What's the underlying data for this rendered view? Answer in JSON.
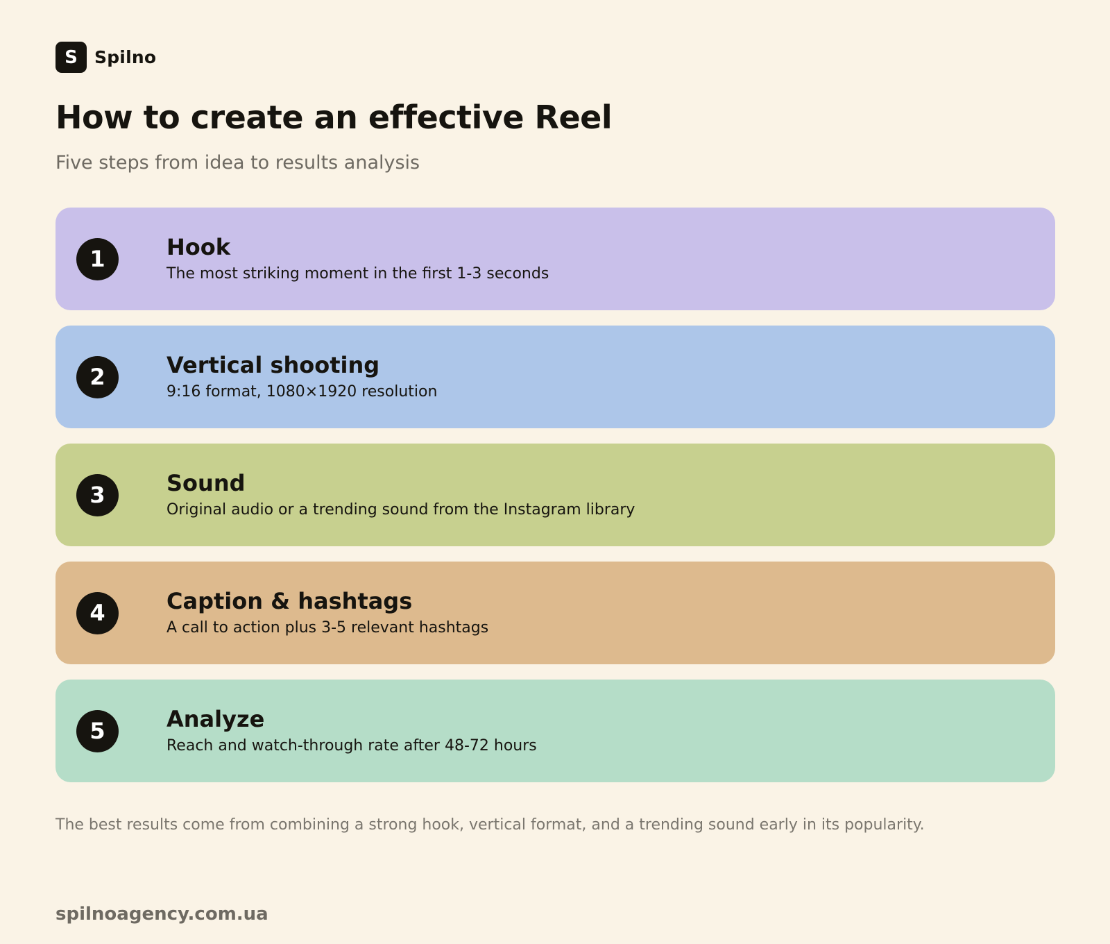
{
  "brand": {
    "mark": "S",
    "name": "Spilno"
  },
  "title": "How to create an effective Reel",
  "subtitle": "Five steps from idea to results analysis",
  "steps": [
    {
      "number": "1",
      "title": "Hook",
      "description": "The most striking moment in the first 1-3 seconds",
      "color": "#C9C0EA"
    },
    {
      "number": "2",
      "title": "Vertical shooting",
      "description": "9:16 format, 1080×1920 resolution",
      "color": "#ADC6E9"
    },
    {
      "number": "3",
      "title": "Sound",
      "description": "Original audio or a trending sound from the Instagram library",
      "color": "#C7D08F"
    },
    {
      "number": "4",
      "title": "Caption & hashtags",
      "description": "A call to action plus 3-5 relevant hashtags",
      "color": "#DDBA8E"
    },
    {
      "number": "5",
      "title": "Analyze",
      "description": "Reach and watch-through rate after 48-72 hours",
      "color": "#B5DDC8"
    }
  ],
  "note": "The best results come from combining a strong hook, vertical format, and a trending sound early in its popularity.",
  "footer": "spilnoagency.com.ua"
}
